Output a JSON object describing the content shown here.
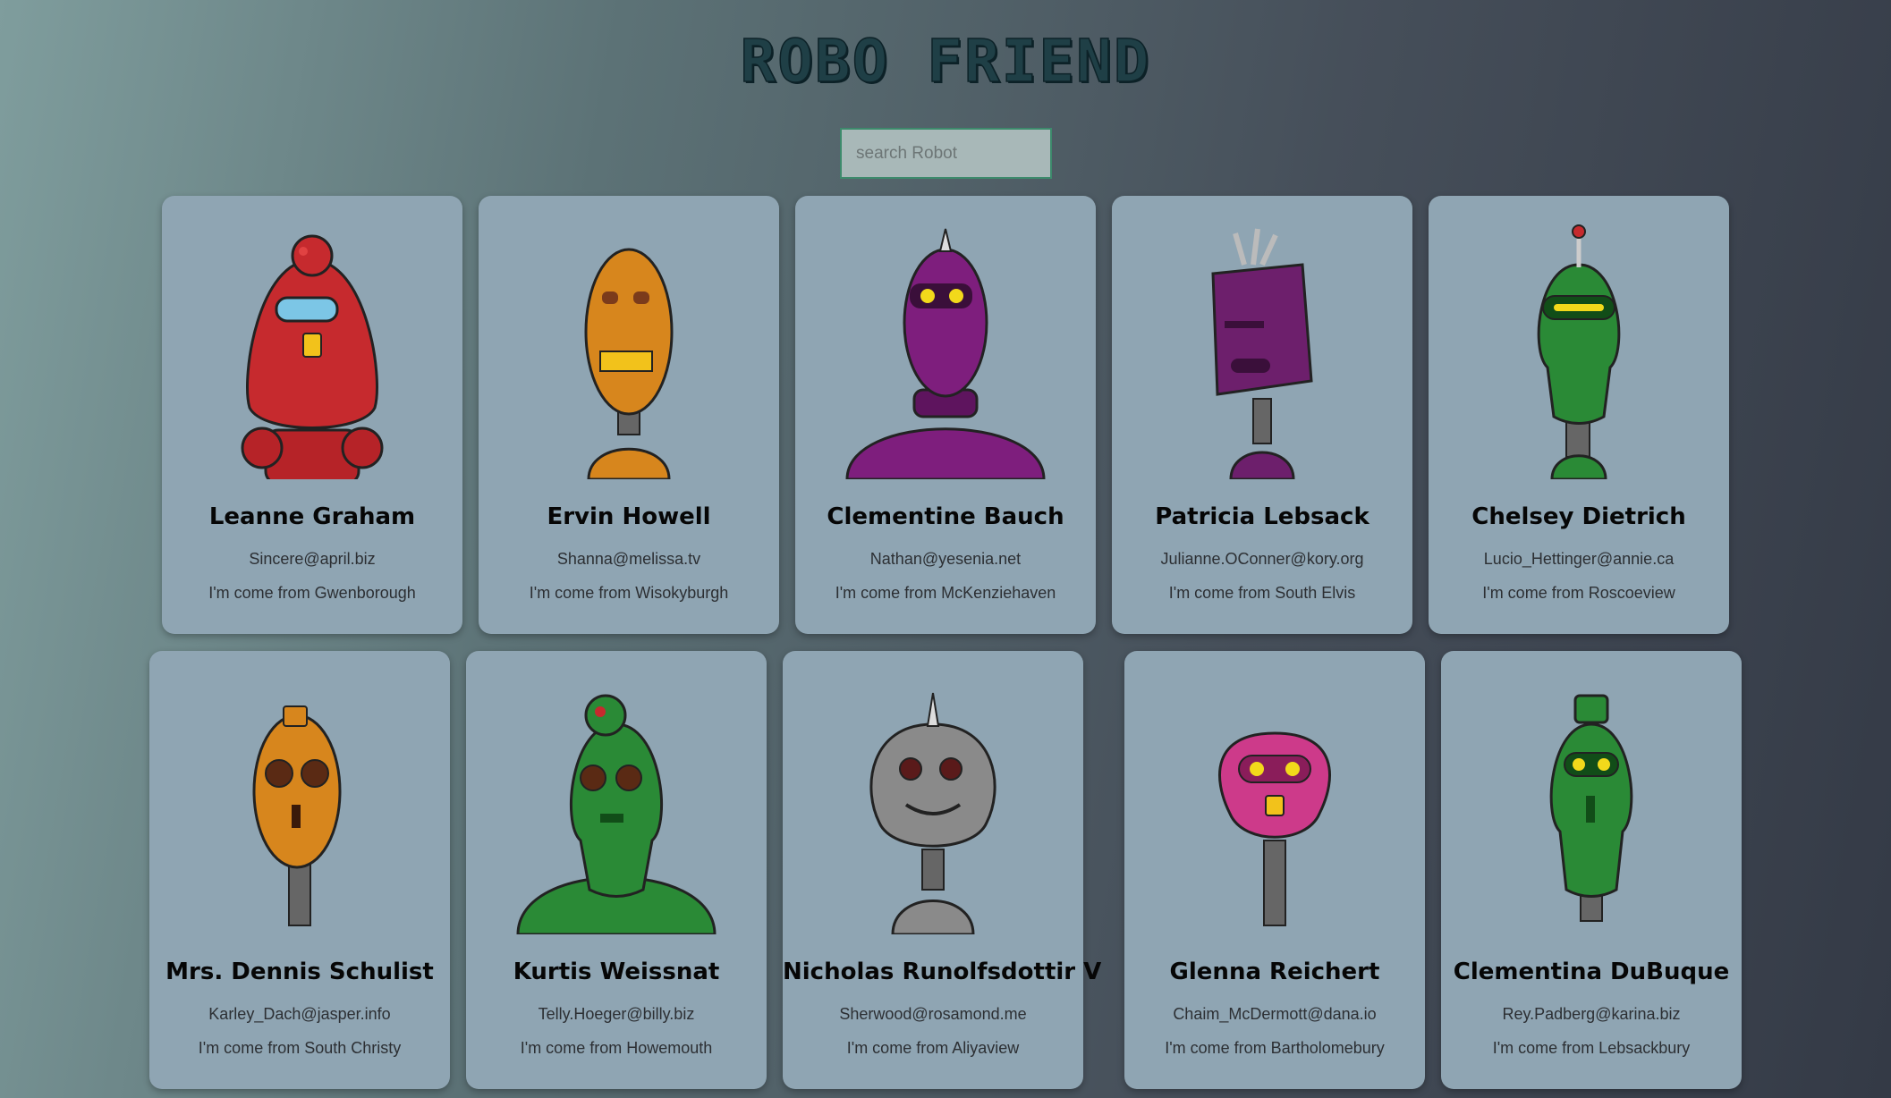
{
  "header": {
    "title": "ROBO FRIEND"
  },
  "search": {
    "placeholder": "search Robot",
    "value": ""
  },
  "robots": [
    {
      "name": "Leanne Graham",
      "email": "Sincere@april.biz",
      "city": "I'm come from Gwenborough",
      "color": "#c62a2e"
    },
    {
      "name": "Ervin Howell",
      "email": "Shanna@melissa.tv",
      "city": "I'm come from Wisokyburgh",
      "color": "#d7861d"
    },
    {
      "name": "Clementine Bauch",
      "email": "Nathan@yesenia.net",
      "city": "I'm come from McKenziehaven",
      "color": "#7e1e7d"
    },
    {
      "name": "Patricia Lebsack",
      "email": "Julianne.OConner@kory.org",
      "city": "I'm come from South Elvis",
      "color": "#6d1f6c"
    },
    {
      "name": "Chelsey Dietrich",
      "email": "Lucio_Hettinger@annie.ca",
      "city": "I'm come from Roscoeview",
      "color": "#2a8a36"
    },
    {
      "name": "Mrs. Dennis Schulist",
      "email": "Karley_Dach@jasper.info",
      "city": "I'm come from South Christy",
      "color": "#d7861d"
    },
    {
      "name": "Kurtis Weissnat",
      "email": "Telly.Hoeger@billy.biz",
      "city": "I'm come from Howemouth",
      "color": "#2a8a36"
    },
    {
      "name": "Nicholas Runolfsdottir V",
      "email": "Sherwood@rosamond.me",
      "city": "I'm come from Aliyaview",
      "color": "#8a8a8a"
    },
    {
      "name": "Glenna Reichert",
      "email": "Chaim_McDermott@dana.io",
      "city": "I'm come from Bartholomebury",
      "color": "#cd3a8a"
    },
    {
      "name": "Clementina DuBuque",
      "email": "Rey.Padberg@karina.biz",
      "city": "I'm come from Lebsackbury",
      "color": "#2a8a36"
    }
  ]
}
